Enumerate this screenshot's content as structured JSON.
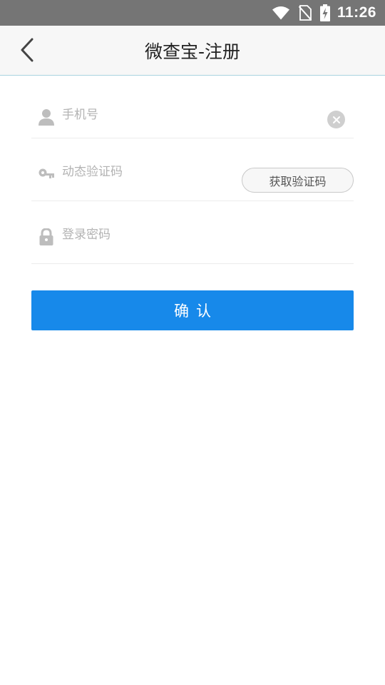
{
  "status_bar": {
    "time": "11:26",
    "icons": [
      "wifi-icon",
      "no-sim-icon",
      "battery-charging-icon"
    ]
  },
  "header": {
    "title": "微查宝-注册",
    "back_icon": "chevron-left-icon"
  },
  "form": {
    "phone": {
      "placeholder": "手机号",
      "value": "",
      "icon": "user-icon",
      "clear_icon": "close-icon"
    },
    "code": {
      "placeholder": "动态验证码",
      "value": "",
      "icon": "key-icon",
      "button_label": "获取验证码"
    },
    "password": {
      "placeholder": "登录密码",
      "value": "",
      "icon": "lock-icon"
    },
    "confirm_label": "确认"
  },
  "colors": {
    "status_bar_bg": "#757575",
    "app_bar_bg": "#f7f7f7",
    "accent": "#1789ea",
    "placeholder": "#b3b3b3",
    "divider": "#ececec"
  }
}
